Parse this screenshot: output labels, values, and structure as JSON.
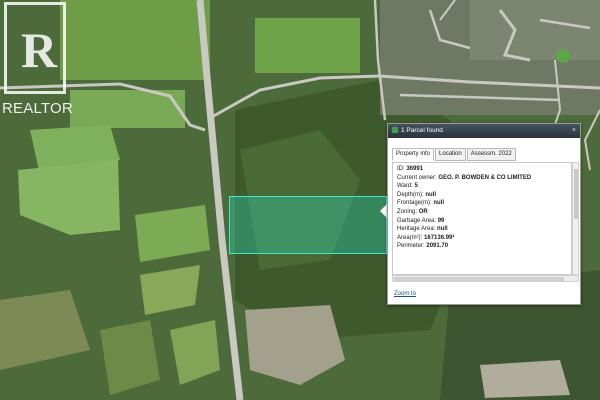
{
  "watermark": {
    "text": "REALTOR",
    "letter": "R"
  },
  "popup": {
    "title": "1 Parcel found",
    "close_icon": "×",
    "tabs": [
      {
        "label": "Property info",
        "active": true
      },
      {
        "label": "Location",
        "active": false
      },
      {
        "label": "Assessm. 2022",
        "active": false
      }
    ],
    "rows": [
      {
        "label": "ID:",
        "value": "36991"
      },
      {
        "label": "Current owner:",
        "value": "GEO. P. BOWDEN & CO LIMITED"
      },
      {
        "label": "Ward:",
        "value": "5"
      },
      {
        "label": "Depth(m):",
        "value": "null"
      },
      {
        "label": "Frontage(m):",
        "value": "null"
      },
      {
        "label": "Zoning:",
        "value": "OR"
      },
      {
        "label": "Garbage Area:",
        "value": "99"
      },
      {
        "label": "Heritage Area:",
        "value": "null"
      },
      {
        "label": "Area(m²):",
        "value": "167136.99²"
      },
      {
        "label": "Perimeter:",
        "value": "2091.70"
      }
    ],
    "zoom_link": "Zoom to"
  },
  "colors": {
    "parcel_fill": "#28dcbe",
    "titlebar": "#36414b",
    "link": "#1a4fa0"
  }
}
